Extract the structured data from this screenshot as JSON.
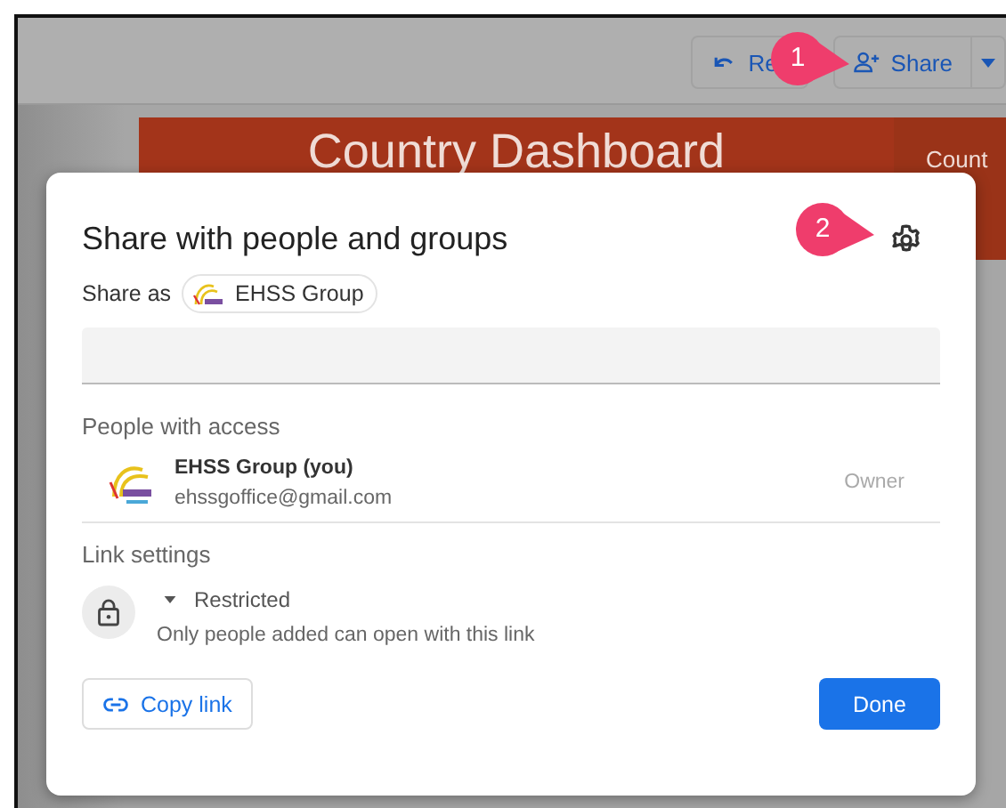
{
  "toolbar": {
    "buttons": [
      {
        "label": "Re",
        "kind": "undo"
      },
      {
        "label": "Share",
        "kind": "share"
      }
    ],
    "callout": "1"
  },
  "background": {
    "banner_title": "Country Dashboard",
    "side_tab": "Count"
  },
  "dialog": {
    "title": "Share with people and groups",
    "callout": "2",
    "share_as": {
      "label": "Share as",
      "name": "EHSS Group"
    },
    "people_section": "People with access",
    "people": [
      {
        "name": "EHSS Group (you)",
        "email": "ehssgoffice@gmail.com",
        "role": "Owner"
      }
    ],
    "link_section": "Link settings",
    "link": {
      "access": "Restricted",
      "description": "Only people added can open with this link"
    },
    "buttons": [
      {
        "label": "Copy link",
        "kind": "copy"
      },
      {
        "label": "Done",
        "kind": "primary"
      }
    ]
  }
}
